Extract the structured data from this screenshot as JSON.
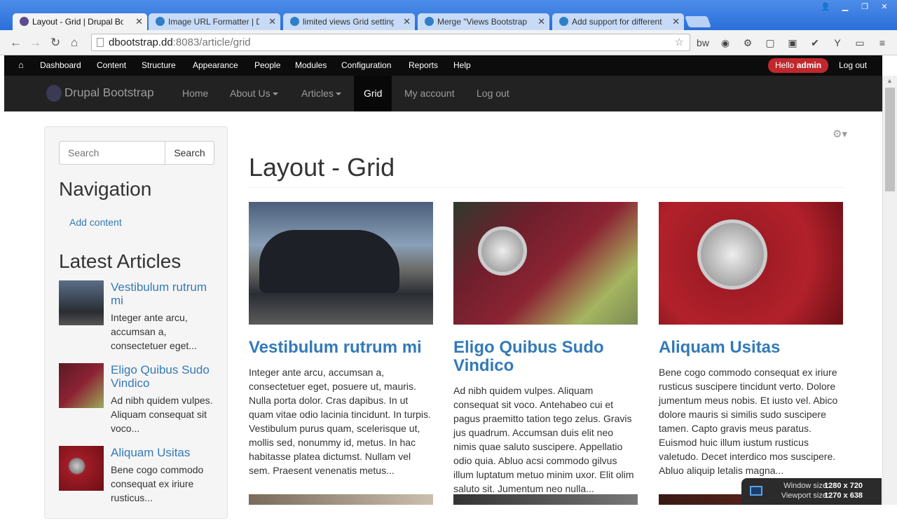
{
  "browser": {
    "tabs": [
      {
        "title": "Layout - Grid | Drupal Boo",
        "active": true
      },
      {
        "title": "Image URL Formatter | Dr",
        "active": false
      },
      {
        "title": "limited views Grid setting",
        "active": false
      },
      {
        "title": "Merge \"Views Bootstrap R",
        "active": false
      },
      {
        "title": "Add support for different",
        "active": false
      }
    ],
    "url_host": "dbootstrap.dd",
    "url_path": ":8083/article/grid"
  },
  "admin_bar": {
    "items": [
      "Dashboard",
      "Content",
      "Structure",
      "Appearance",
      "People",
      "Modules",
      "Configuration",
      "Reports",
      "Help"
    ],
    "hello_prefix": "Hello ",
    "hello_user": "admin",
    "logout": "Log out"
  },
  "site_nav": {
    "brand": "Drupal Bootstrap",
    "items": [
      "Home",
      "About Us",
      "Articles",
      "Grid",
      "My account",
      "Log out"
    ],
    "active": "Grid"
  },
  "sidebar": {
    "search_placeholder": "Search",
    "search_button": "Search",
    "nav_heading": "Navigation",
    "nav_link": "Add content",
    "latest_heading": "Latest Articles",
    "articles": [
      {
        "title": "Vestibulum rutrum mi",
        "desc": "Integer ante arcu, accumsan a, consectetuer eget..."
      },
      {
        "title": "Eligo Quibus Sudo Vindico",
        "desc": "Ad nibh quidem vulpes. Aliquam consequat sit voco..."
      },
      {
        "title": "Aliquam Usitas",
        "desc": "Bene cogo commodo consequat ex iriure rusticus..."
      }
    ]
  },
  "main": {
    "title": "Layout - Grid",
    "cards": [
      {
        "title": "Vestibulum rutrum mi",
        "desc": "Integer ante arcu, accumsan a, consectetuer eget, posuere ut, mauris. Nulla porta dolor. Cras dapibus. In ut quam vitae odio lacinia tincidunt. In turpis. Vestibulum purus quam, scelerisque ut, mollis sed, nonummy id, metus. In hac habitasse platea dictumst. Nullam vel sem. Praesent venenatis metus..."
      },
      {
        "title": "Eligo Quibus Sudo Vindico",
        "desc": "Ad nibh quidem vulpes. Aliquam consequat sit voco. Antehabeo cui et pagus praemitto tation tego zelus. Gravis jus quadrum. Accumsan duis elit neo nimis quae saluto suscipere. Appellatio odio quia. Abluo acsi commodo gilvus illum luptatum metuo minim uxor. Elit olim saluto sit. Jumentum neo nulla..."
      },
      {
        "title": "Aliquam Usitas",
        "desc": "Bene cogo commodo consequat ex iriure rusticus suscipere tincidunt verto. Dolore jumentum meus nobis. Et iusto vel. Abico dolore mauris si similis sudo suscipere tamen. Capto gravis meus paratus. Euismod huic illum iustum rusticus valetudo. Decet interdico mos suscipere. Abluo aliquip letalis magna..."
      }
    ]
  },
  "window_size": {
    "window_label": "Window size:",
    "window_value": "1280 x 720",
    "viewport_label": "Viewport size:",
    "viewport_value": "1270 x 638"
  }
}
